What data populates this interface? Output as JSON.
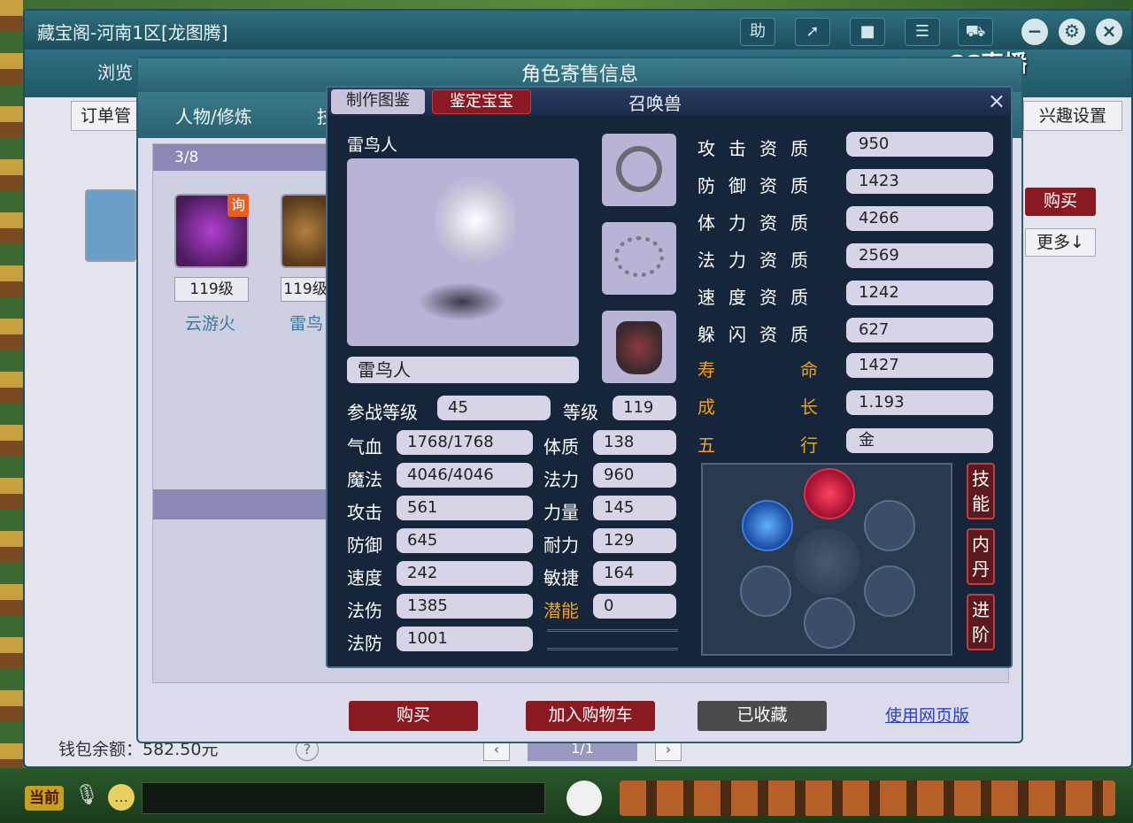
{
  "window": {
    "title": "藏宝阁-河南1区[龙图腾]",
    "help_label": "助",
    "brand": "CC直播"
  },
  "store": {
    "tab_browse": "浏览",
    "tab_orders": "订单管",
    "interest_settings": "兴趣设置",
    "buy_label": "购买",
    "more_label": "更多↓",
    "wallet_label": "钱包余额：582.50元",
    "page_indicator": "1/1"
  },
  "sale_dialog": {
    "title": "角色寄售信息",
    "tabs": [
      "人物/修炼",
      "技"
    ],
    "page_count": "3/8",
    "pets": [
      {
        "level": "119级",
        "name": "云游火",
        "badge": "询"
      },
      {
        "level": "119级",
        "name": "雷鸟"
      }
    ],
    "buttons": {
      "buy": "购买",
      "add_cart": "加入购物车",
      "favorited": "已收藏",
      "web_version": "使用网页版"
    }
  },
  "pet_dialog": {
    "tab_catalog": "制作图鉴",
    "tab_identify": "鉴定宝宝",
    "title": "召唤兽",
    "pet_name": "雷鸟人",
    "display_name": "雷鸟人",
    "battle_level_label": "参战等级",
    "battle_level": "45",
    "level_label": "等级",
    "level": "119",
    "stats_left": [
      {
        "label": "气血",
        "value": "1768/1768"
      },
      {
        "label": "魔法",
        "value": "4046/4046"
      },
      {
        "label": "攻击",
        "value": "561"
      },
      {
        "label": "防御",
        "value": "645"
      },
      {
        "label": "速度",
        "value": "242"
      },
      {
        "label": "法伤",
        "value": "1385"
      },
      {
        "label": "法防",
        "value": "1001"
      }
    ],
    "stats_right": [
      {
        "label": "体质",
        "value": "138"
      },
      {
        "label": "法力",
        "value": "960"
      },
      {
        "label": "力量",
        "value": "145"
      },
      {
        "label": "耐力",
        "value": "129"
      },
      {
        "label": "敏捷",
        "value": "164"
      },
      {
        "label": "潜能",
        "value": "0"
      }
    ],
    "aptitudes": [
      {
        "label": "攻击资质",
        "value": "950"
      },
      {
        "label": "防御资质",
        "value": "1423"
      },
      {
        "label": "体力资质",
        "value": "4266"
      },
      {
        "label": "法力资质",
        "value": "2569"
      },
      {
        "label": "速度资质",
        "value": "1242"
      },
      {
        "label": "躲闪资质",
        "value": "627"
      }
    ],
    "lifespan_label": "寿命",
    "lifespan": "1427",
    "growth_label": "成长",
    "growth": "1.193",
    "element_label": "五行",
    "element": "金",
    "side_tabs": [
      "技能",
      "内丹",
      "进阶"
    ]
  },
  "bottom_bar": {
    "current": "当前"
  },
  "colors": {
    "accent_red": "#8a1a22",
    "accent_gold": "#f0a020",
    "field_bg": "#d6d4e6"
  }
}
